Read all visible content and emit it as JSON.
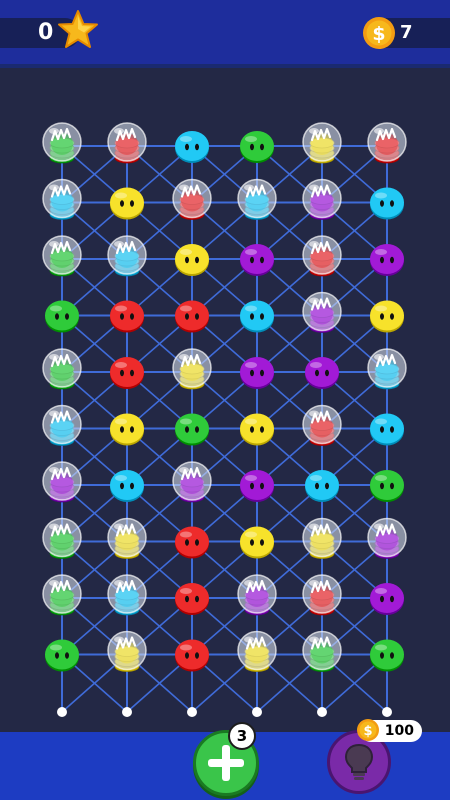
{
  "hud": {
    "score": "0",
    "coins": "7",
    "add_badge": "3",
    "hint_cost": "100"
  },
  "icons": {
    "score": "star-icon",
    "coins": "coin-icon",
    "add": "plus-icon",
    "hint": "lightbulb-icon"
  },
  "colors": {
    "green": "#2fcb3a",
    "red": "#ee2b2b",
    "cyan": "#21c9f5",
    "yellow": "#f7e22b",
    "purple": "#a21ad6",
    "board_bg": "#232845",
    "top_bar": "#1e2d9c",
    "bottom_bar": "#1d3cc2"
  },
  "grid": {
    "columns": 6,
    "rows": 10,
    "cells": [
      [
        "green-locked",
        "red-locked",
        "cyan",
        "green",
        "yellow-locked",
        "red-locked"
      ],
      [
        "cyan-locked",
        "yellow",
        "red-locked",
        "cyan-locked",
        "purple-locked",
        "cyan"
      ],
      [
        "green-locked",
        "cyan-locked",
        "yellow",
        "purple",
        "red-locked",
        "purple"
      ],
      [
        "green",
        "red",
        "red",
        "cyan",
        "purple-locked",
        "yellow"
      ],
      [
        "green-locked",
        "red",
        "yellow-locked",
        "purple",
        "purple",
        "cyan-locked"
      ],
      [
        "cyan-locked",
        "yellow",
        "green",
        "yellow",
        "red-locked",
        "cyan"
      ],
      [
        "purple-locked",
        "cyan",
        "purple-locked",
        "purple",
        "cyan",
        "green"
      ],
      [
        "green-locked",
        "yellow-locked",
        "red",
        "yellow",
        "yellow-locked",
        "purple-locked"
      ],
      [
        "green-locked",
        "cyan-locked",
        "red",
        "purple-locked",
        "red-locked",
        "purple"
      ],
      [
        "green",
        "yellow-locked",
        "red",
        "yellow-locked",
        "green-locked",
        "green"
      ]
    ]
  }
}
